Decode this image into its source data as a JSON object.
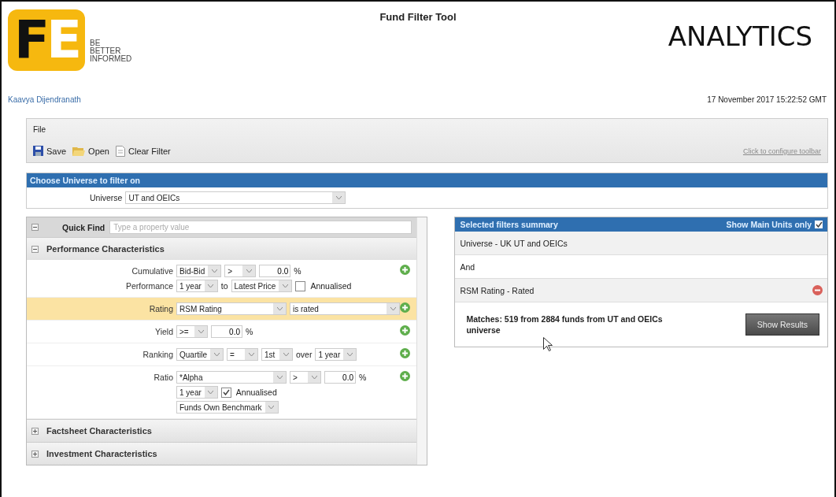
{
  "header": {
    "logo_letters": [
      "F",
      "E"
    ],
    "tagline": [
      "BE",
      "BETTER",
      "INFORMED"
    ],
    "title": "Fund Filter Tool",
    "brand": "ANALYTICS",
    "user": "Kaavya Dijendranath",
    "datetime": "17 November 2017 15:22:52 GMT"
  },
  "toolbar": {
    "menu": [
      "File"
    ],
    "buttons": [
      {
        "label": "Save",
        "kind": "save"
      },
      {
        "label": "Open",
        "kind": "open"
      },
      {
        "label": "Clear Filter",
        "kind": "clear"
      }
    ],
    "configure_link": "Click to configure toolbar"
  },
  "universe": {
    "header": "Choose Universe to filter on",
    "label": "Universe",
    "value": "UT and OEICs"
  },
  "filters": {
    "quick_find": {
      "label": "Quick Find",
      "placeholder": "Type a property value"
    },
    "sections": [
      {
        "title": "Performance Characteristics",
        "expanded": true,
        "rows": [
          {
            "highlighted": false,
            "lines": [
              {
                "label": "Cumulative",
                "controls": [
                  {
                    "kind": "select",
                    "value": "Bid-Bid"
                  },
                  {
                    "kind": "select",
                    "value": ">"
                  },
                  {
                    "kind": "number",
                    "value": "0.0"
                  },
                  {
                    "kind": "text",
                    "text": "%"
                  }
                ]
              },
              {
                "label": "Performance",
                "controls": [
                  {
                    "kind": "select",
                    "value": "1 year"
                  },
                  {
                    "kind": "text",
                    "text": "to"
                  },
                  {
                    "kind": "select",
                    "value": "Latest Price"
                  },
                  {
                    "kind": "checkbox",
                    "checked": false,
                    "label": "Annualised"
                  }
                ]
              }
            ]
          },
          {
            "highlighted": true,
            "lines": [
              {
                "label": "Rating",
                "controls": [
                  {
                    "kind": "select",
                    "value": "RSM Rating",
                    "wide": true
                  },
                  {
                    "kind": "select",
                    "value": "is rated",
                    "wide": true
                  }
                ]
              }
            ]
          },
          {
            "highlighted": false,
            "lines": [
              {
                "label": "Yield",
                "controls": [
                  {
                    "kind": "select",
                    "value": ">="
                  },
                  {
                    "kind": "number",
                    "value": "0.0"
                  },
                  {
                    "kind": "text",
                    "text": "%"
                  }
                ]
              }
            ]
          },
          {
            "highlighted": false,
            "lines": [
              {
                "label": "Ranking",
                "controls": [
                  {
                    "kind": "select",
                    "value": "Quartile"
                  },
                  {
                    "kind": "select",
                    "value": "="
                  },
                  {
                    "kind": "select",
                    "value": "1st"
                  },
                  {
                    "kind": "text",
                    "text": "over"
                  },
                  {
                    "kind": "select",
                    "value": "1 year"
                  }
                ]
              }
            ]
          },
          {
            "highlighted": false,
            "lines": [
              {
                "label": "Ratio",
                "controls": [
                  {
                    "kind": "select",
                    "value": "*Alpha",
                    "wide": true
                  },
                  {
                    "kind": "select",
                    "value": ">"
                  },
                  {
                    "kind": "number",
                    "value": "0.0"
                  },
                  {
                    "kind": "text",
                    "text": "%"
                  }
                ]
              },
              {
                "controls": [
                  {
                    "kind": "select",
                    "value": "1 year"
                  },
                  {
                    "kind": "checkbox",
                    "checked": true,
                    "label": "Annualised"
                  }
                ]
              },
              {
                "controls": [
                  {
                    "kind": "select",
                    "value": "Funds Own Benchmark"
                  }
                ]
              }
            ]
          }
        ]
      },
      {
        "title": "Factsheet Characteristics",
        "expanded": false
      },
      {
        "title": "Investment Characteristics",
        "expanded": false
      }
    ]
  },
  "summary": {
    "title": "Selected filters summary",
    "main_units": {
      "label": "Show Main Units only",
      "checked": true
    },
    "items": [
      {
        "text": "Universe - UK UT and OEICs",
        "removable": false
      },
      {
        "text": "And",
        "removable": false
      },
      {
        "text": "RSM Rating - Rated",
        "removable": true
      }
    ],
    "matches": "Matches: 519 from 2884 funds from UT and OEICs universe",
    "button": "Show Results"
  }
}
